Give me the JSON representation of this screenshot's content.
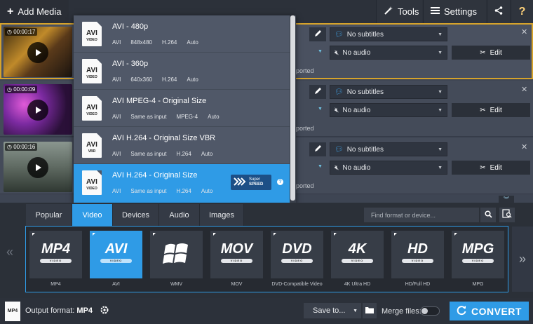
{
  "topbar": {
    "add_media": "Add Media",
    "tools": "Tools",
    "settings": "Settings",
    "help": "?"
  },
  "files": [
    {
      "timecode": "00:00:17",
      "subtitles": "No subtitles",
      "audio": "No audio",
      "edit": "Edit",
      "note": "pported"
    },
    {
      "timecode": "00:00:09",
      "subtitles": "No subtitles",
      "audio": "No audio",
      "edit": "Edit",
      "note": "pported"
    },
    {
      "timecode": "00:00:16",
      "subtitles": "No subtitles",
      "audio": "No audio",
      "edit": "Edit",
      "note": "pported"
    }
  ],
  "dropdown": {
    "items": [
      {
        "icon": "AVI",
        "icon_sub": "VIDEO",
        "title": "AVI - 480p",
        "fmt": "AVI",
        "res": "848x480",
        "codec": "H.264",
        "audio": "Auto"
      },
      {
        "icon": "AVI",
        "icon_sub": "VIDEO",
        "title": "AVI - 360p",
        "fmt": "AVI",
        "res": "640x360",
        "codec": "H.264",
        "audio": "Auto"
      },
      {
        "icon": "AVI",
        "icon_sub": "VIDEO",
        "title": "AVI MPEG-4 - Original Size",
        "fmt": "AVI",
        "res": "Same as input",
        "codec": "MPEG-4",
        "audio": "Auto"
      },
      {
        "icon": "AVI",
        "icon_sub": "VBR",
        "title": "AVI H.264 - Original Size VBR",
        "fmt": "AVI",
        "res": "Same as input",
        "codec": "H.264",
        "audio": "Auto"
      },
      {
        "icon": "AVI",
        "icon_sub": "VIDEO",
        "title": "AVI H.264 - Original Size",
        "fmt": "AVI",
        "res": "Same as input",
        "codec": "H.264",
        "audio": "Auto"
      }
    ],
    "super_speed_line1": "Super",
    "super_speed_line2": "SPEED",
    "help": "?"
  },
  "panel": {
    "tabs": [
      {
        "label": "Popular"
      },
      {
        "label": "Video"
      },
      {
        "label": "Devices"
      },
      {
        "label": "Audio"
      },
      {
        "label": "Images"
      }
    ],
    "search_placeholder": "Find format or device...",
    "formats": [
      {
        "logo": "MP4",
        "pill": "VIDEO",
        "caption": "MP4"
      },
      {
        "logo": "AVI",
        "pill": "VIDEO",
        "caption": "AVI"
      },
      {
        "logo": "",
        "pill": "",
        "caption": "WMV"
      },
      {
        "logo": "MOV",
        "pill": "VIDEO",
        "caption": "MOV"
      },
      {
        "logo": "DVD",
        "pill": "VIDEO",
        "caption": "DVD-Compatible Video"
      },
      {
        "logo": "4K",
        "pill": "VIDEO",
        "caption": "4K Ultra HD"
      },
      {
        "logo": "HD",
        "pill": "VIDEO",
        "caption": "HD/Full HD"
      },
      {
        "logo": "MPG",
        "pill": "VIDEO",
        "caption": "MPG"
      }
    ],
    "nav_left": "«",
    "nav_right": "»"
  },
  "bottom": {
    "output_label": "Output format:",
    "output_value": "MP4",
    "save_to": "Save to...",
    "merge": "Merge files:",
    "convert": "CONVERT",
    "file_icon_text": "MP4"
  }
}
